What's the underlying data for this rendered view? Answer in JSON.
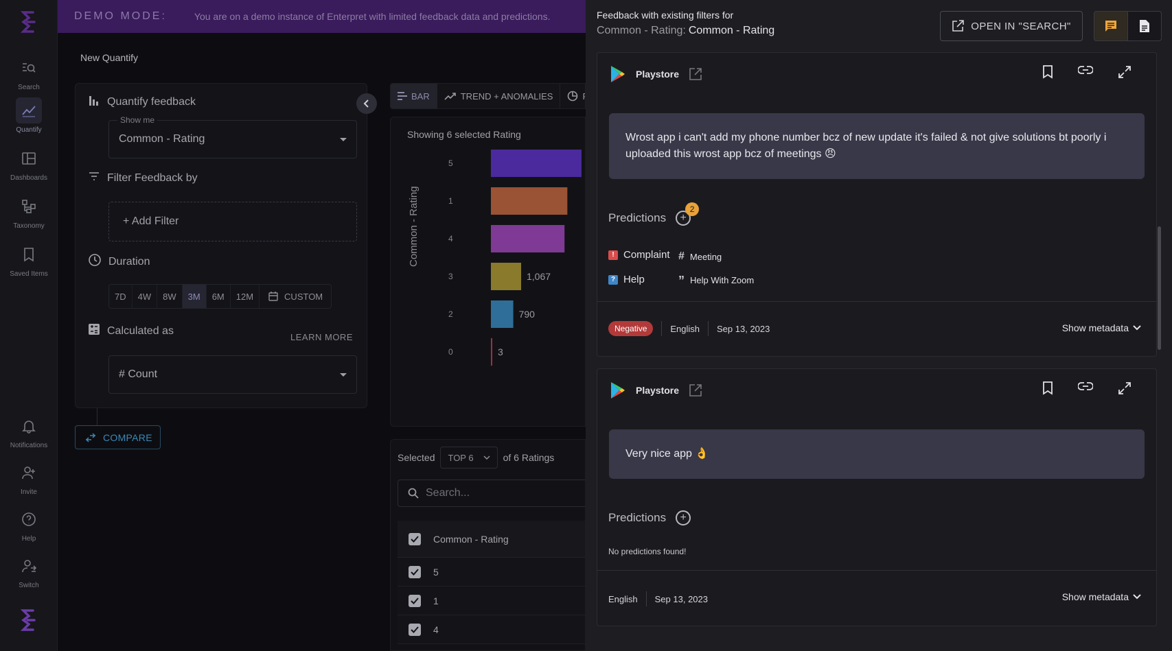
{
  "colors": {
    "accent": "#6a3ca8",
    "banner": "#3a1b5c",
    "compare": "#3b89b8",
    "negative": "#b33a3a",
    "badge": "#e8a23a"
  },
  "sidebar": {
    "items": [
      {
        "label": "Search",
        "icon": "search-icon"
      },
      {
        "label": "Quantify",
        "icon": "quantify-icon",
        "active": true
      },
      {
        "label": "Dashboards",
        "icon": "dashboard-icon"
      },
      {
        "label": "Taxonomy",
        "icon": "taxonomy-icon"
      },
      {
        "label": "Saved Items",
        "icon": "bookmark-icon"
      },
      {
        "label": "Notifications",
        "icon": "bell-icon"
      },
      {
        "label": "Invite",
        "icon": "invite-icon"
      },
      {
        "label": "Help",
        "icon": "help-icon"
      },
      {
        "label": "Switch",
        "icon": "switch-icon"
      }
    ]
  },
  "banner": {
    "title": "DEMO MODE:",
    "text": "You are on a demo instance of Enterpret with limited feedback data and predictions."
  },
  "page": {
    "title": "New Quantify"
  },
  "config": {
    "quantify_title": "Quantify feedback",
    "show_me_label": "Show me",
    "show_me_value": "Common - Rating",
    "filter_title": "Filter Feedback by",
    "add_filter": "+ Add Filter",
    "duration_title": "Duration",
    "durations": [
      "7D",
      "4W",
      "8W",
      "3M",
      "6M",
      "12M"
    ],
    "duration_active": "3M",
    "custom_label": "CUSTOM",
    "calculated_title": "Calculated as",
    "learn_more": "LEARN MORE",
    "calculated_value": "# Count",
    "compare": "COMPARE"
  },
  "chart_tabs": {
    "bar": "BAR",
    "trend": "TREND + ANOMALIES",
    "pie": "PI"
  },
  "chart_data": {
    "type": "bar",
    "orientation": "horizontal",
    "subtitle": "Showing 6 selected Rating",
    "ylabel": "Common - Rating",
    "categories": [
      "5",
      "1",
      "4",
      "3",
      "2",
      "0"
    ],
    "values": [
      3200,
      2700,
      2600,
      1067,
      790,
      3
    ],
    "data_labels": [
      null,
      null,
      null,
      "1,067",
      "790",
      "3"
    ],
    "colors": [
      "#4a2a9c",
      "#9a5334",
      "#7e3a94",
      "#8a7a2c",
      "#2f6e98",
      "#a03040"
    ]
  },
  "table": {
    "selected_label": "Selected",
    "top_value": "TOP 6",
    "of_label": "of 6 Ratings",
    "search_placeholder": "Search...",
    "column": "Common - Rating",
    "rows": [
      "5",
      "1",
      "4"
    ]
  },
  "drawer": {
    "title_line1": "Feedback with existing filters for",
    "title_line2_prefix": "Common - Rating:",
    "title_line2_value": "Common - Rating",
    "open_search": "OPEN IN \"SEARCH\"",
    "feedback": [
      {
        "source": "Playstore",
        "text": "Wrost app i can't add my phone number bcz of new update it's failed & not give solutions bt poorly i uploaded this wrost app bcz of meetings 😠",
        "predictions_label": "Predictions",
        "prediction_count": "2",
        "predictions": [
          {
            "label": "Complaint",
            "icon": "complaint-icon",
            "color": "#d94c4c"
          },
          {
            "label": "Meeting",
            "icon": "hashtag-icon"
          },
          {
            "label": "Help",
            "icon": "help-tag-icon",
            "color": "#3f86c8"
          },
          {
            "label": "Help With Zoom",
            "icon": "quote-icon"
          }
        ],
        "sentiment": "Negative",
        "language": "English",
        "date": "Sep 13, 2023",
        "show_metadata": "Show metadata"
      },
      {
        "source": "Playstore",
        "text": "Very nice app 👌",
        "predictions_label": "Predictions",
        "no_predictions": "No predictions found!",
        "language": "English",
        "date": "Sep 13, 2023",
        "show_metadata": "Show metadata"
      }
    ]
  }
}
